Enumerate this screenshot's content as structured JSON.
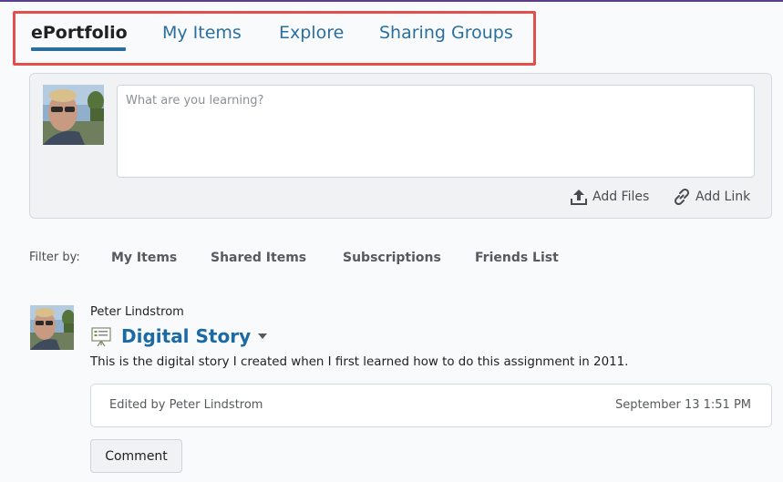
{
  "nav": {
    "tabs": [
      {
        "label": "ePortfolio",
        "active": true
      },
      {
        "label": "My Items",
        "active": false
      },
      {
        "label": "Explore",
        "active": false
      },
      {
        "label": "Sharing Groups",
        "active": false
      }
    ],
    "highlight_color": "#e2504b",
    "link_color": "#2a6f9e"
  },
  "composer": {
    "placeholder": "What are you learning?",
    "value": "",
    "add_files_label": "Add Files",
    "add_files_icon": "upload-icon",
    "add_link_label": "Add Link",
    "add_link_icon": "link-icon"
  },
  "filter": {
    "label": "Filter by:",
    "options": [
      "My Items",
      "Shared Items",
      "Subscriptions",
      "Friends List"
    ]
  },
  "feed": {
    "items": [
      {
        "author": "Peter Lindstrom",
        "type_icon": "presentation-icon",
        "title": "Digital Story",
        "title_color": "#1a6aa3",
        "description": "This is the digital story I created when I first learned how to do this assignment in 2011.",
        "edited_by": "Edited by Peter Lindstrom",
        "date": "September 13 1:51 PM",
        "comment_label": "Comment"
      }
    ]
  }
}
